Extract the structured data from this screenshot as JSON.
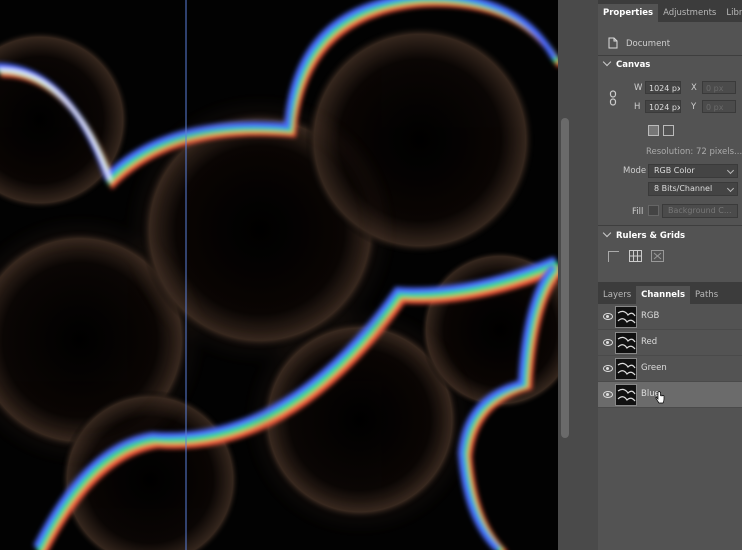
{
  "panel": {
    "top_tabs": [
      "Properties",
      "Adjustments",
      "Librari"
    ],
    "document_label": "Document",
    "canvas": {
      "title": "Canvas",
      "w_label": "W",
      "w_value": "1024 px",
      "x_label": "X",
      "x_value": "0 px",
      "h_label": "H",
      "h_value": "1024 px",
      "y_label": "Y",
      "y_value": "0 px",
      "resolution": "Resolution: 72 pixels...",
      "mode_label": "Mode",
      "mode_value": "RGB Color",
      "bits_value": "8 Bits/Channel",
      "fill_label": "Fill",
      "fill_value": "Background C..."
    },
    "rulers": {
      "title": "Rulers & Grids"
    },
    "bottom_tabs": [
      "Layers",
      "Channels",
      "Paths"
    ],
    "channels": [
      {
        "name": "RGB"
      },
      {
        "name": "Red"
      },
      {
        "name": "Green"
      },
      {
        "name": "Blue"
      }
    ]
  },
  "colors": {
    "panel_bg": "#535353",
    "tab_bar": "#3c3c3c",
    "selected_row": "#6b6b6b",
    "glow_red": "#ff5a3c",
    "glow_green": "#38e07a",
    "glow_blue": "#4a6bff"
  },
  "icons": [
    "document-icon",
    "link-chain-icon",
    "portrait-icon",
    "landscape-icon",
    "eye-icon",
    "cursor-icon"
  ]
}
